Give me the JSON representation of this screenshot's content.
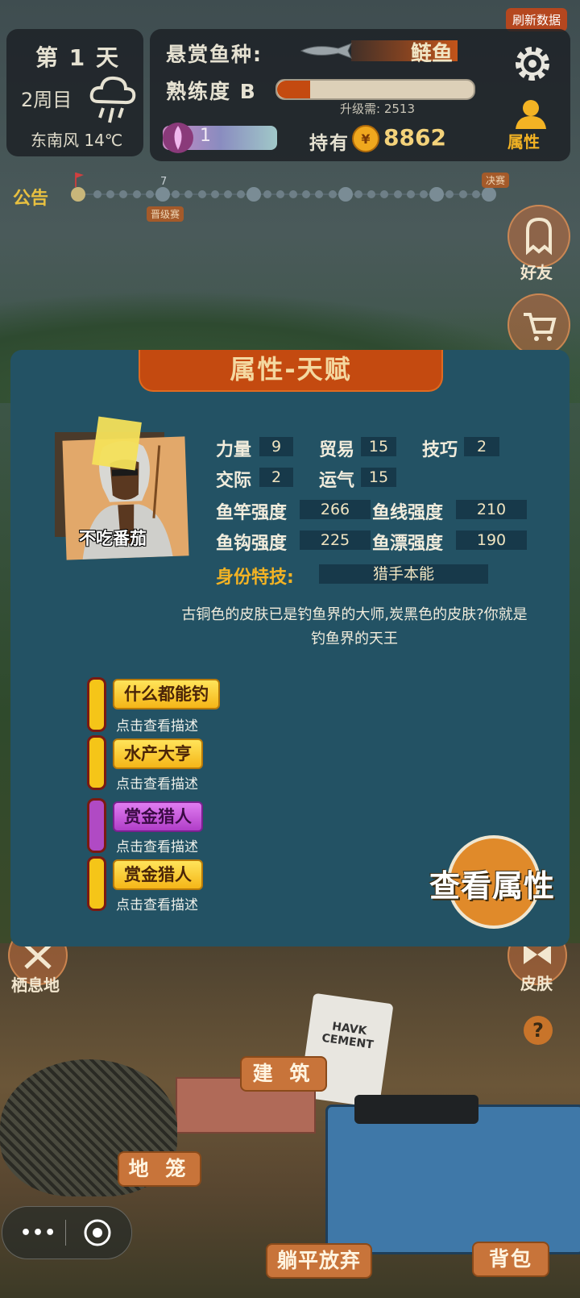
{
  "top": {
    "refresh_label": "刷新数据",
    "day": "第 1 天",
    "cycle": "2周目",
    "weather": "东南风 14℃",
    "bounty_label": "悬赏鱼种:",
    "bounty_fish": "鲢鱼",
    "skill_label": "熟练度 B",
    "skill_progress": 0.17,
    "upgrade_need": "升级需: 2513",
    "gem_count": "1",
    "hold_label": "持有",
    "coins": "8862",
    "attr_label": "属性"
  },
  "timeline": {
    "announce": "公告",
    "mark_7": "7",
    "promo": "晋级赛",
    "final": "决赛"
  },
  "side": {
    "friends": "好友",
    "habitat": "栖息地",
    "skin": "皮肤",
    "help": "?"
  },
  "modal": {
    "title": "属性-天赋",
    "player_name": "不吃番茄",
    "stats": {
      "strength_label": "力量",
      "strength": "9",
      "trade_label": "贸易",
      "trade": "15",
      "skill_label": "技巧",
      "skill": "2",
      "social_label": "交际",
      "social": "2",
      "luck_label": "运气",
      "luck": "15",
      "rod_label": "鱼竿强度",
      "rod": "266",
      "line_label": "鱼线强度",
      "line": "210",
      "hook_label": "鱼钩强度",
      "hook": "225",
      "float_label": "鱼漂强度",
      "float": "190"
    },
    "identity_label": "身份特技:",
    "identity_value": "猎手本能",
    "description": "古铜色的皮肤已是钓鱼界的大师,炭黑色的皮肤?你就是钓鱼界的天王",
    "talents": [
      {
        "name": "什么都能钓",
        "hint": "点击查看描述",
        "color": "#f5c518"
      },
      {
        "name": "水产大亨",
        "hint": "点击查看描述",
        "color": "#f5c518"
      },
      {
        "name": "赏金猎人",
        "hint": "点击查看描述",
        "color": "#b04ac4"
      },
      {
        "name": "赏金猎人",
        "hint": "点击查看描述",
        "color": "#f5c518"
      }
    ],
    "view_attr_label": "查看属性"
  },
  "scene": {
    "build": "建 筑",
    "cage": "地 笼",
    "lie_flat": "躺平放弃",
    "bag": "背包",
    "cement_text": "HAVK CEMENT"
  },
  "icons": [
    "cloud-rain-icon",
    "gear-icon",
    "person-icon",
    "coin-icon",
    "gem-icon",
    "ghost-icon",
    "cart-icon",
    "crossbones-icon",
    "bow-icon",
    "help-icon",
    "more-icon",
    "target-icon"
  ]
}
